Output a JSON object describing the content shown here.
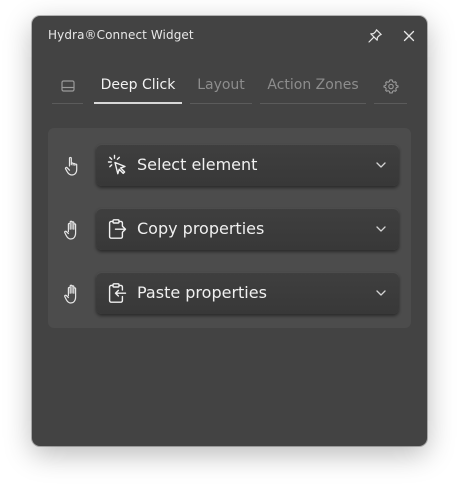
{
  "window": {
    "title": "Hydra®Connect Widget",
    "pin_icon": "pin-icon",
    "close_icon": "close-icon"
  },
  "tabs": [
    {
      "label": "",
      "icon": "keyboard-panel-icon",
      "active": false
    },
    {
      "label": "Deep Click",
      "active": true
    },
    {
      "label": "Layout",
      "active": false
    },
    {
      "label": "Action Zones",
      "active": false
    },
    {
      "label": "",
      "icon": "gear-icon",
      "active": false
    }
  ],
  "actions": [
    {
      "label": "Select element",
      "icon": "pointer-click-icon",
      "handle_icon": "hand-pointing-icon"
    },
    {
      "label": "Copy properties",
      "icon": "clipboard-export-icon",
      "handle_icon": "hand-open-icon"
    },
    {
      "label": "Paste properties",
      "icon": "clipboard-import-icon",
      "handle_icon": "hand-open-icon"
    }
  ],
  "colors": {
    "window_bg": "#434343",
    "panel_bg": "#4c4c4c",
    "dropdown_bg": "#3b3b3b",
    "text_primary": "#f0f0f0",
    "text_muted": "#8d8d8d"
  }
}
